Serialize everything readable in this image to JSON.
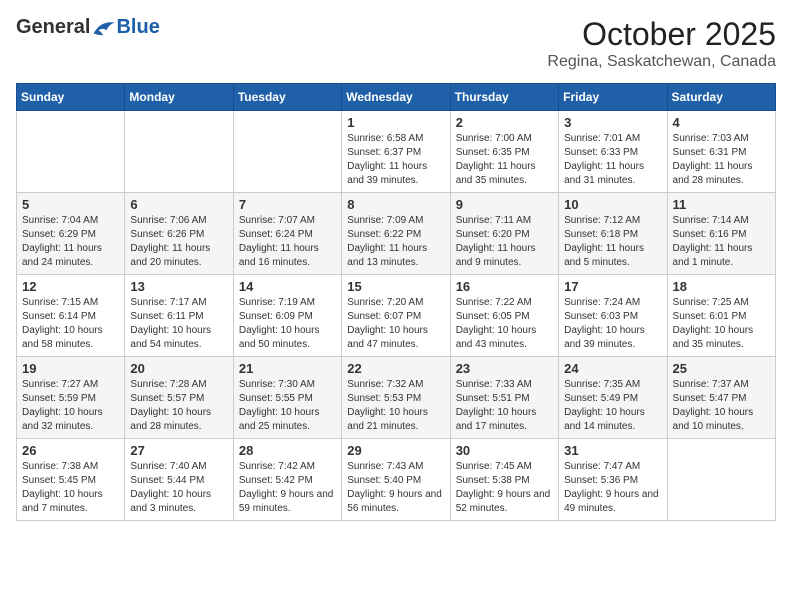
{
  "logo": {
    "general": "General",
    "blue": "Blue"
  },
  "title": "October 2025",
  "location": "Regina, Saskatchewan, Canada",
  "days_of_week": [
    "Sunday",
    "Monday",
    "Tuesday",
    "Wednesday",
    "Thursday",
    "Friday",
    "Saturday"
  ],
  "weeks": [
    [
      {
        "day": "",
        "info": ""
      },
      {
        "day": "",
        "info": ""
      },
      {
        "day": "",
        "info": ""
      },
      {
        "day": "1",
        "info": "Sunrise: 6:58 AM\nSunset: 6:37 PM\nDaylight: 11 hours\nand 39 minutes."
      },
      {
        "day": "2",
        "info": "Sunrise: 7:00 AM\nSunset: 6:35 PM\nDaylight: 11 hours\nand 35 minutes."
      },
      {
        "day": "3",
        "info": "Sunrise: 7:01 AM\nSunset: 6:33 PM\nDaylight: 11 hours\nand 31 minutes."
      },
      {
        "day": "4",
        "info": "Sunrise: 7:03 AM\nSunset: 6:31 PM\nDaylight: 11 hours\nand 28 minutes."
      }
    ],
    [
      {
        "day": "5",
        "info": "Sunrise: 7:04 AM\nSunset: 6:29 PM\nDaylight: 11 hours\nand 24 minutes."
      },
      {
        "day": "6",
        "info": "Sunrise: 7:06 AM\nSunset: 6:26 PM\nDaylight: 11 hours\nand 20 minutes."
      },
      {
        "day": "7",
        "info": "Sunrise: 7:07 AM\nSunset: 6:24 PM\nDaylight: 11 hours\nand 16 minutes."
      },
      {
        "day": "8",
        "info": "Sunrise: 7:09 AM\nSunset: 6:22 PM\nDaylight: 11 hours\nand 13 minutes."
      },
      {
        "day": "9",
        "info": "Sunrise: 7:11 AM\nSunset: 6:20 PM\nDaylight: 11 hours\nand 9 minutes."
      },
      {
        "day": "10",
        "info": "Sunrise: 7:12 AM\nSunset: 6:18 PM\nDaylight: 11 hours\nand 5 minutes."
      },
      {
        "day": "11",
        "info": "Sunrise: 7:14 AM\nSunset: 6:16 PM\nDaylight: 11 hours\nand 1 minute."
      }
    ],
    [
      {
        "day": "12",
        "info": "Sunrise: 7:15 AM\nSunset: 6:14 PM\nDaylight: 10 hours\nand 58 minutes."
      },
      {
        "day": "13",
        "info": "Sunrise: 7:17 AM\nSunset: 6:11 PM\nDaylight: 10 hours\nand 54 minutes."
      },
      {
        "day": "14",
        "info": "Sunrise: 7:19 AM\nSunset: 6:09 PM\nDaylight: 10 hours\nand 50 minutes."
      },
      {
        "day": "15",
        "info": "Sunrise: 7:20 AM\nSunset: 6:07 PM\nDaylight: 10 hours\nand 47 minutes."
      },
      {
        "day": "16",
        "info": "Sunrise: 7:22 AM\nSunset: 6:05 PM\nDaylight: 10 hours\nand 43 minutes."
      },
      {
        "day": "17",
        "info": "Sunrise: 7:24 AM\nSunset: 6:03 PM\nDaylight: 10 hours\nand 39 minutes."
      },
      {
        "day": "18",
        "info": "Sunrise: 7:25 AM\nSunset: 6:01 PM\nDaylight: 10 hours\nand 35 minutes."
      }
    ],
    [
      {
        "day": "19",
        "info": "Sunrise: 7:27 AM\nSunset: 5:59 PM\nDaylight: 10 hours\nand 32 minutes."
      },
      {
        "day": "20",
        "info": "Sunrise: 7:28 AM\nSunset: 5:57 PM\nDaylight: 10 hours\nand 28 minutes."
      },
      {
        "day": "21",
        "info": "Sunrise: 7:30 AM\nSunset: 5:55 PM\nDaylight: 10 hours\nand 25 minutes."
      },
      {
        "day": "22",
        "info": "Sunrise: 7:32 AM\nSunset: 5:53 PM\nDaylight: 10 hours\nand 21 minutes."
      },
      {
        "day": "23",
        "info": "Sunrise: 7:33 AM\nSunset: 5:51 PM\nDaylight: 10 hours\nand 17 minutes."
      },
      {
        "day": "24",
        "info": "Sunrise: 7:35 AM\nSunset: 5:49 PM\nDaylight: 10 hours\nand 14 minutes."
      },
      {
        "day": "25",
        "info": "Sunrise: 7:37 AM\nSunset: 5:47 PM\nDaylight: 10 hours\nand 10 minutes."
      }
    ],
    [
      {
        "day": "26",
        "info": "Sunrise: 7:38 AM\nSunset: 5:45 PM\nDaylight: 10 hours\nand 7 minutes."
      },
      {
        "day": "27",
        "info": "Sunrise: 7:40 AM\nSunset: 5:44 PM\nDaylight: 10 hours\nand 3 minutes."
      },
      {
        "day": "28",
        "info": "Sunrise: 7:42 AM\nSunset: 5:42 PM\nDaylight: 9 hours\nand 59 minutes."
      },
      {
        "day": "29",
        "info": "Sunrise: 7:43 AM\nSunset: 5:40 PM\nDaylight: 9 hours\nand 56 minutes."
      },
      {
        "day": "30",
        "info": "Sunrise: 7:45 AM\nSunset: 5:38 PM\nDaylight: 9 hours\nand 52 minutes."
      },
      {
        "day": "31",
        "info": "Sunrise: 7:47 AM\nSunset: 5:36 PM\nDaylight: 9 hours\nand 49 minutes."
      },
      {
        "day": "",
        "info": ""
      }
    ]
  ]
}
